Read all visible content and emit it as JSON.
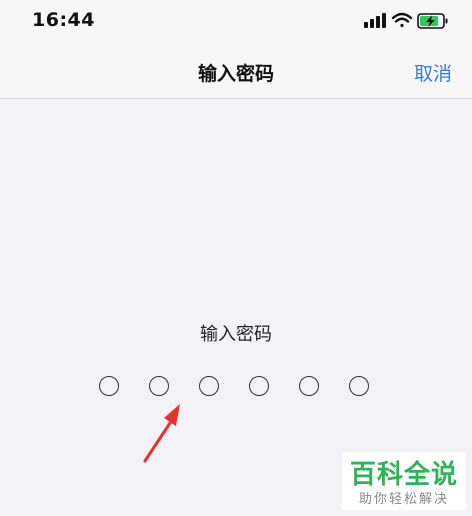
{
  "status_bar": {
    "time": "16:44",
    "icons": [
      "signal-icon",
      "wifi-icon",
      "battery-charging-icon"
    ]
  },
  "nav_bar": {
    "title": "输入密码",
    "cancel_label": "取消"
  },
  "passcode": {
    "prompt": "输入密码",
    "digit_count": 6,
    "digits_entered": 0
  },
  "watermark": {
    "title": "百科全说",
    "subtitle": "助你轻松解决"
  },
  "colors": {
    "accent": "#3a7dd8",
    "annotation_arrow": "#e8302f",
    "watermark_green": "#2fb35a",
    "battery_green": "#34c759"
  }
}
